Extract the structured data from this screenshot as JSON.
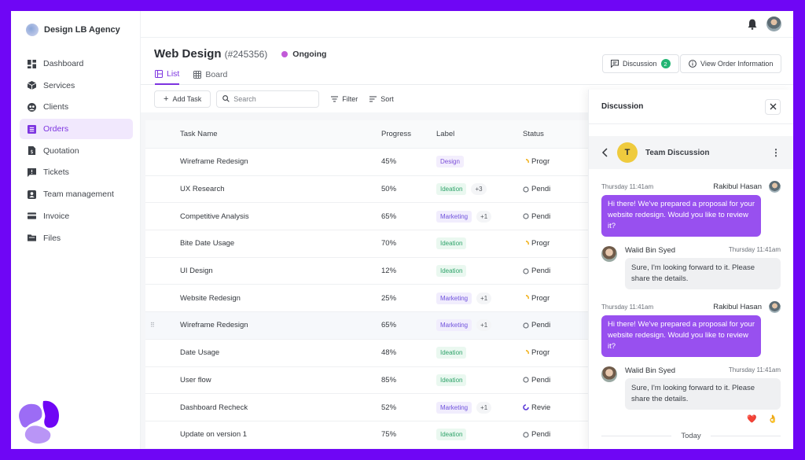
{
  "brand": {
    "name": "Design LB Agency"
  },
  "sidebar": {
    "items": [
      {
        "label": "Dashboard",
        "icon": "dashboard-icon",
        "active": false
      },
      {
        "label": "Services",
        "icon": "box-icon",
        "active": false
      },
      {
        "label": "Clients",
        "icon": "clients-icon",
        "active": false
      },
      {
        "label": "Orders",
        "icon": "orders-icon",
        "active": true
      },
      {
        "label": "Quotation",
        "icon": "quotation-icon",
        "active": false
      },
      {
        "label": "Tickets",
        "icon": "ticket-icon",
        "active": false
      },
      {
        "label": "Team management",
        "icon": "team-icon",
        "active": false
      },
      {
        "label": "Invoice",
        "icon": "invoice-icon",
        "active": false
      },
      {
        "label": "Files",
        "icon": "folder-icon",
        "active": false
      }
    ]
  },
  "header": {
    "title": "Web Design",
    "order_id": "(#245356)",
    "status": "Ongoing",
    "discussion_label": "Discussion",
    "discussion_count": "2",
    "order_info_label": "View Order Information",
    "tabs": [
      {
        "label": "List",
        "active": true
      },
      {
        "label": "Board",
        "active": false
      }
    ]
  },
  "toolbar": {
    "add_task_label": "Add Task",
    "search_placeholder": "Search",
    "filter_label": "Filter",
    "sort_label": "Sort"
  },
  "table": {
    "columns": [
      "Task Name",
      "Progress",
      "Label",
      "Status"
    ],
    "rows": [
      {
        "name": "Wireframe Redesign",
        "progress": "45%",
        "label": "Design",
        "label_type": "design",
        "extra": "",
        "status": "Progr",
        "status_type": "progress"
      },
      {
        "name": "UX Research",
        "progress": "50%",
        "label": "Ideation",
        "label_type": "ideation",
        "extra": "+3",
        "status": "Pendi",
        "status_type": "pending"
      },
      {
        "name": "Competitive Analysis",
        "progress": "65%",
        "label": "Marketing",
        "label_type": "marketing",
        "extra": "+1",
        "status": "Pendi",
        "status_type": "pending"
      },
      {
        "name": "Bite Date Usage",
        "progress": "70%",
        "label": "Ideation",
        "label_type": "ideation",
        "extra": "",
        "status": "Progr",
        "status_type": "progress"
      },
      {
        "name": "UI Design",
        "progress": "12%",
        "label": "Ideation",
        "label_type": "ideation",
        "extra": "",
        "status": "Pendi",
        "status_type": "pending"
      },
      {
        "name": "Website Redesign",
        "progress": "25%",
        "label": "Marketing",
        "label_type": "marketing",
        "extra": "+1",
        "status": "Progr",
        "status_type": "progress"
      },
      {
        "name": "Wireframe Redesign",
        "progress": "65%",
        "label": "Marketing",
        "label_type": "marketing",
        "extra": "+1",
        "status": "Pendi",
        "status_type": "pending",
        "hover": true
      },
      {
        "name": "Date Usage",
        "progress": "48%",
        "label": "Ideation",
        "label_type": "ideation",
        "extra": "",
        "status": "Progr",
        "status_type": "progress"
      },
      {
        "name": "User flow",
        "progress": "85%",
        "label": "Ideation",
        "label_type": "ideation",
        "extra": "",
        "status": "Pendi",
        "status_type": "pending"
      },
      {
        "name": "Dashboard Recheck",
        "progress": "52%",
        "label": "Marketing",
        "label_type": "marketing",
        "extra": "+1",
        "status": "Revie",
        "status_type": "review"
      },
      {
        "name": "Update on version 1",
        "progress": "75%",
        "label": "Ideation",
        "label_type": "ideation",
        "extra": "",
        "status": "Pendi",
        "status_type": "pending"
      }
    ]
  },
  "discussion": {
    "title": "Discussion",
    "team_initial": "T",
    "team_name": "Team Discussion",
    "messages": [
      {
        "direction": "out",
        "time": "Thursday 11:41am",
        "sender": "Rakibul Hasan",
        "text": "Hi there! We've prepared a proposal for your website redesign. Would you like to review it?"
      },
      {
        "direction": "in",
        "time": "Thursday 11:41am",
        "sender": "Walid Bin Syed",
        "text": "Sure, I'm looking forward to it. Please share the details."
      },
      {
        "direction": "out",
        "time": "Thursday 11:41am",
        "sender": "Rakibul Hasan",
        "text": "Hi there! We've prepared a proposal for your website redesign. Would you like to review it?"
      },
      {
        "direction": "in",
        "time": "Thursday 11:41am",
        "sender": "Walid Bin Syed",
        "text": "Sure, I'm looking forward to it. Please share the details.",
        "reactions": [
          "❤️",
          "👌"
        ]
      }
    ],
    "divider": "Today"
  },
  "colors": {
    "accent": "#7d34e0",
    "frame": "#6f06f5",
    "bubble_out": "#9850ef",
    "badge": "#22b573",
    "status_ongoing": "#c25ad8"
  }
}
